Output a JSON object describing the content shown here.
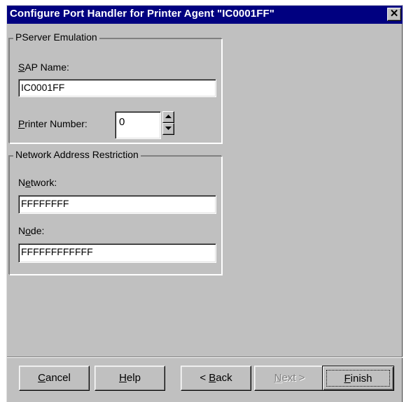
{
  "window": {
    "title": "Configure Port Handler for Printer Agent \"IC0001FF\"",
    "close_glyph": "✕"
  },
  "pserver_group": {
    "legend": "PServer Emulation",
    "sap_name": {
      "label_mnemonic": "S",
      "label_rest": "AP Name:",
      "value": "IC0001FF"
    },
    "printer_number": {
      "label_mnemonic": "P",
      "label_rest": "rinter Number:",
      "value": "0"
    }
  },
  "network_group": {
    "legend": "Network Address Restriction",
    "network": {
      "label_pre": "N",
      "label_mnemonic": "e",
      "label_rest": "twork:",
      "value": "FFFFFFFF"
    },
    "node": {
      "label_pre": "N",
      "label_mnemonic": "o",
      "label_rest": "de:",
      "value": "FFFFFFFFFFFF"
    }
  },
  "buttons": {
    "cancel": {
      "mnemonic": "C",
      "rest": "ancel"
    },
    "help": {
      "mnemonic": "H",
      "rest": "elp"
    },
    "back": {
      "prefix": "< ",
      "mnemonic": "B",
      "rest": "ack"
    },
    "next": {
      "mnemonic": "N",
      "rest": "ext >"
    },
    "finish": {
      "mnemonic": "F",
      "rest": "inish"
    }
  },
  "icons": {
    "spin_up": "spin-up-arrow-icon",
    "spin_down": "spin-down-arrow-icon",
    "close": "close-icon"
  },
  "colors": {
    "titlebar": "#000080",
    "face": "#c0c0c0",
    "disabled_text": "#808080"
  }
}
